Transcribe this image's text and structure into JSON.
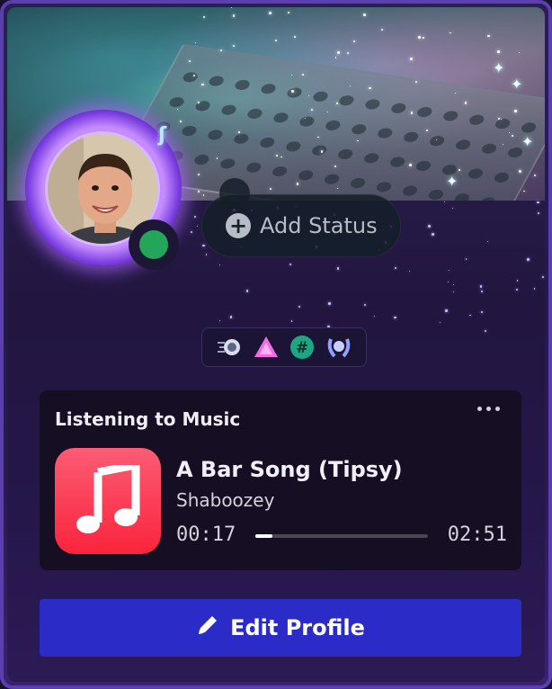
{
  "status_pill": {
    "label": "Add Status",
    "icon": "plus-circle-icon"
  },
  "presence": {
    "status_color": "#23a55a"
  },
  "badges": [
    {
      "icon": "speed-badge-icon"
    },
    {
      "icon": "triangle-badge-icon"
    },
    {
      "icon": "hashtag-badge-icon"
    },
    {
      "icon": "laurel-badge-icon"
    }
  ],
  "activity": {
    "header": "Listening to Music",
    "app_icon": "apple-music-icon",
    "song_title": "A Bar Song (Tipsy)",
    "artist": "Shaboozey",
    "elapsed": "00:17",
    "duration": "02:51",
    "progress_fraction": 0.1
  },
  "edit_button": {
    "label": "Edit Profile",
    "icon": "pencil-icon"
  },
  "colors": {
    "accent": "#2b2bc8",
    "music_red": "#fa243c",
    "avatar_ring": "#a56bff"
  }
}
